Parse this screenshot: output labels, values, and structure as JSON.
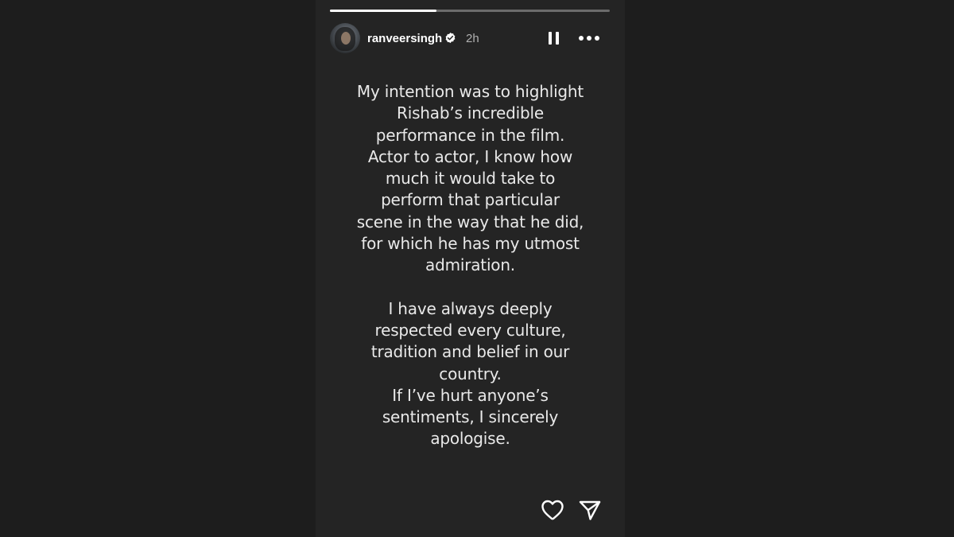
{
  "story": {
    "progress_fraction": 0.38,
    "username": "ranveersingh",
    "time_ago": "2h",
    "message_lines": [
      "My intention was to highlight",
      "Rishab’s incredible",
      "performance in the film.",
      "Actor to actor, I know how",
      "much it would take to",
      "perform that particular",
      "scene in the way that he did,",
      "for which he has my utmost",
      "admiration.",
      "",
      "I have always deeply",
      "respected every culture,",
      "tradition and belief in our",
      "country.",
      "If I’ve hurt anyone’s",
      "sentiments, I sincerely",
      "apologise."
    ]
  },
  "icons": {
    "verified": "verified-badge-icon",
    "pause": "pause-icon",
    "more": "more-options-icon",
    "like": "heart-icon",
    "share": "send-icon"
  },
  "colors": {
    "page_background": "#1d1d1d",
    "story_background": "#242424",
    "text": "#e9e9e9",
    "username": "#ffffff",
    "muted": "#b0b0b0",
    "progress_track": "#6b6b6b",
    "progress_fill": "#ffffff"
  }
}
